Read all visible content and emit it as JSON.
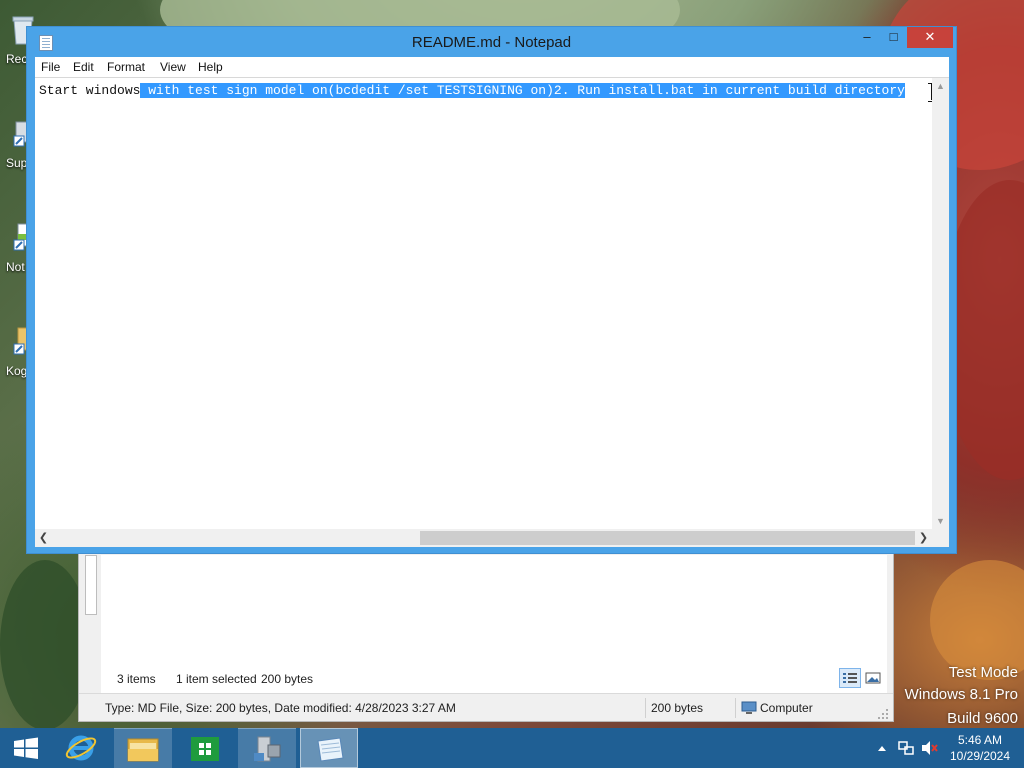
{
  "desktop": {
    "icons": [
      {
        "label": "Rec",
        "name": "recycle-bin"
      },
      {
        "label": "Sup",
        "name": "shortcut-sup"
      },
      {
        "label": "Not",
        "name": "shortcut-notepad"
      },
      {
        "label": "Kog",
        "name": "folder-kog"
      }
    ],
    "watermark": {
      "line1": "Test Mode",
      "line2": "Windows 8.1 Pro",
      "line3": "Build 9600"
    }
  },
  "explorer": {
    "items_count": "3 items",
    "items_selected": "1 item selected",
    "items_size": "200 bytes",
    "status_type": "Type: MD File, Size: 200 bytes, Date modified: 4/28/2023 3:27 AM",
    "status_size": "200 bytes",
    "status_location": "Computer"
  },
  "notepad": {
    "title": "README.md - Notepad",
    "menu": [
      "File",
      "Edit",
      "Format",
      "View",
      "Help"
    ],
    "text_before_selection": "Start windows",
    "text_selected": " with test sign model on(bcdedit /set TESTSIGNING on)2. Run install.bat in current build directory",
    "window_buttons": {
      "minimize": "–",
      "maximize": "□",
      "close": "✕"
    }
  },
  "taskbar": {
    "apps": [
      {
        "name": "internet-explorer",
        "state": "normal"
      },
      {
        "name": "file-explorer",
        "state": "open"
      },
      {
        "name": "store",
        "state": "normal"
      },
      {
        "name": "system-app",
        "state": "open"
      },
      {
        "name": "notepad",
        "state": "active"
      }
    ],
    "clock_time": "5:46 AM",
    "clock_date": "10/29/2024"
  },
  "colors": {
    "title_active": "#4aa3e8",
    "close_button": "#c7423b",
    "selection": "#3399ff",
    "taskbar": "#1f5f94"
  }
}
